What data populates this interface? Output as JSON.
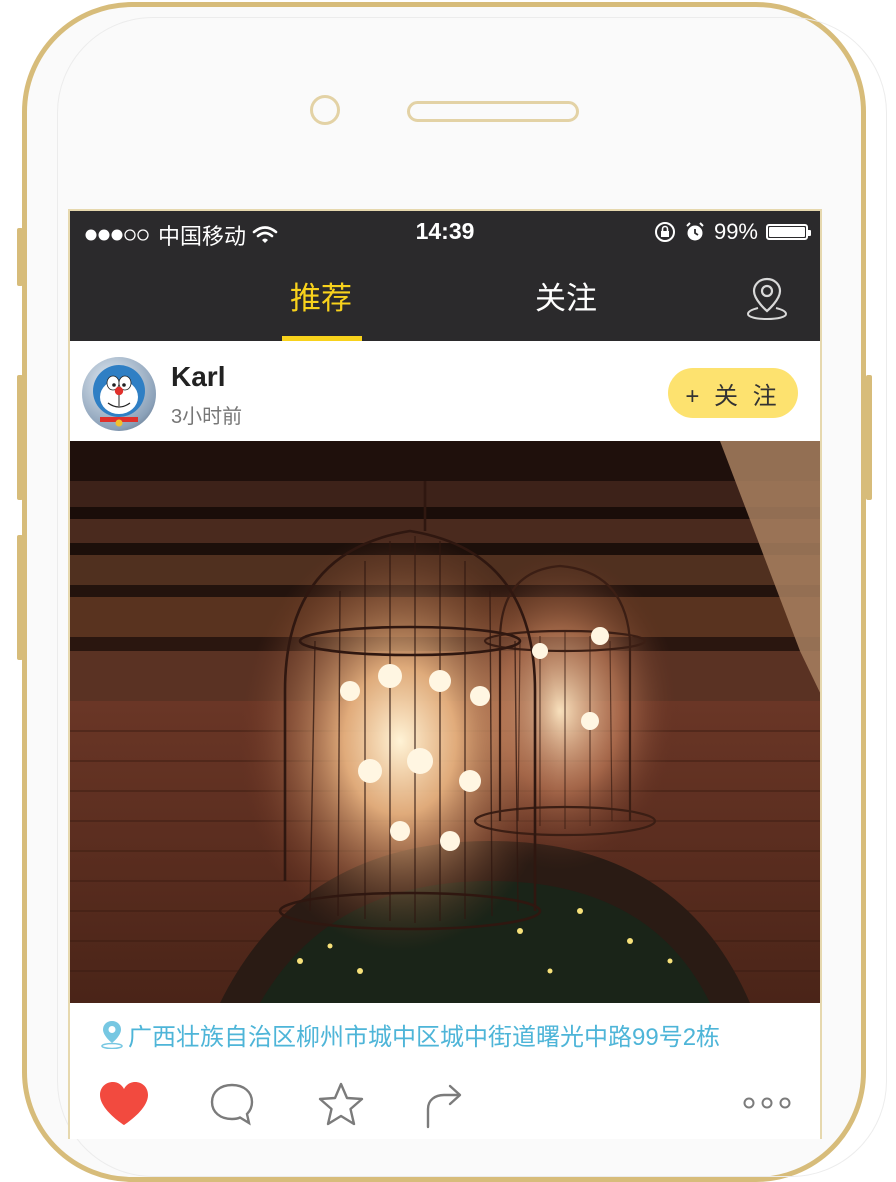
{
  "status_bar": {
    "carrier": "中国移动",
    "time": "14:39",
    "battery": "99%",
    "battery_level": 0.99
  },
  "nav": {
    "tabs": [
      {
        "label": "推荐",
        "active": true
      },
      {
        "label": "关注",
        "active": false
      }
    ],
    "location_icon": "map-pin-icon"
  },
  "post": {
    "username": "Karl",
    "time": "3小时前",
    "follow_label": "+ 关 注",
    "location": "广西壮族自治区柳州市城中区城中街道曙光中路99号2栋"
  },
  "actions": {
    "like_icon": "heart-icon",
    "comment_icon": "comment-icon",
    "favorite_icon": "star-icon",
    "share_icon": "share-icon",
    "more_icon": "more-icon"
  },
  "colors": {
    "accent": "#f8d21c",
    "nav_bg": "#2b2a2c",
    "follow_bg": "#fde26f",
    "location": "#4eb5d8",
    "like": "#f24a3f",
    "frame": "#d7bc7a"
  }
}
